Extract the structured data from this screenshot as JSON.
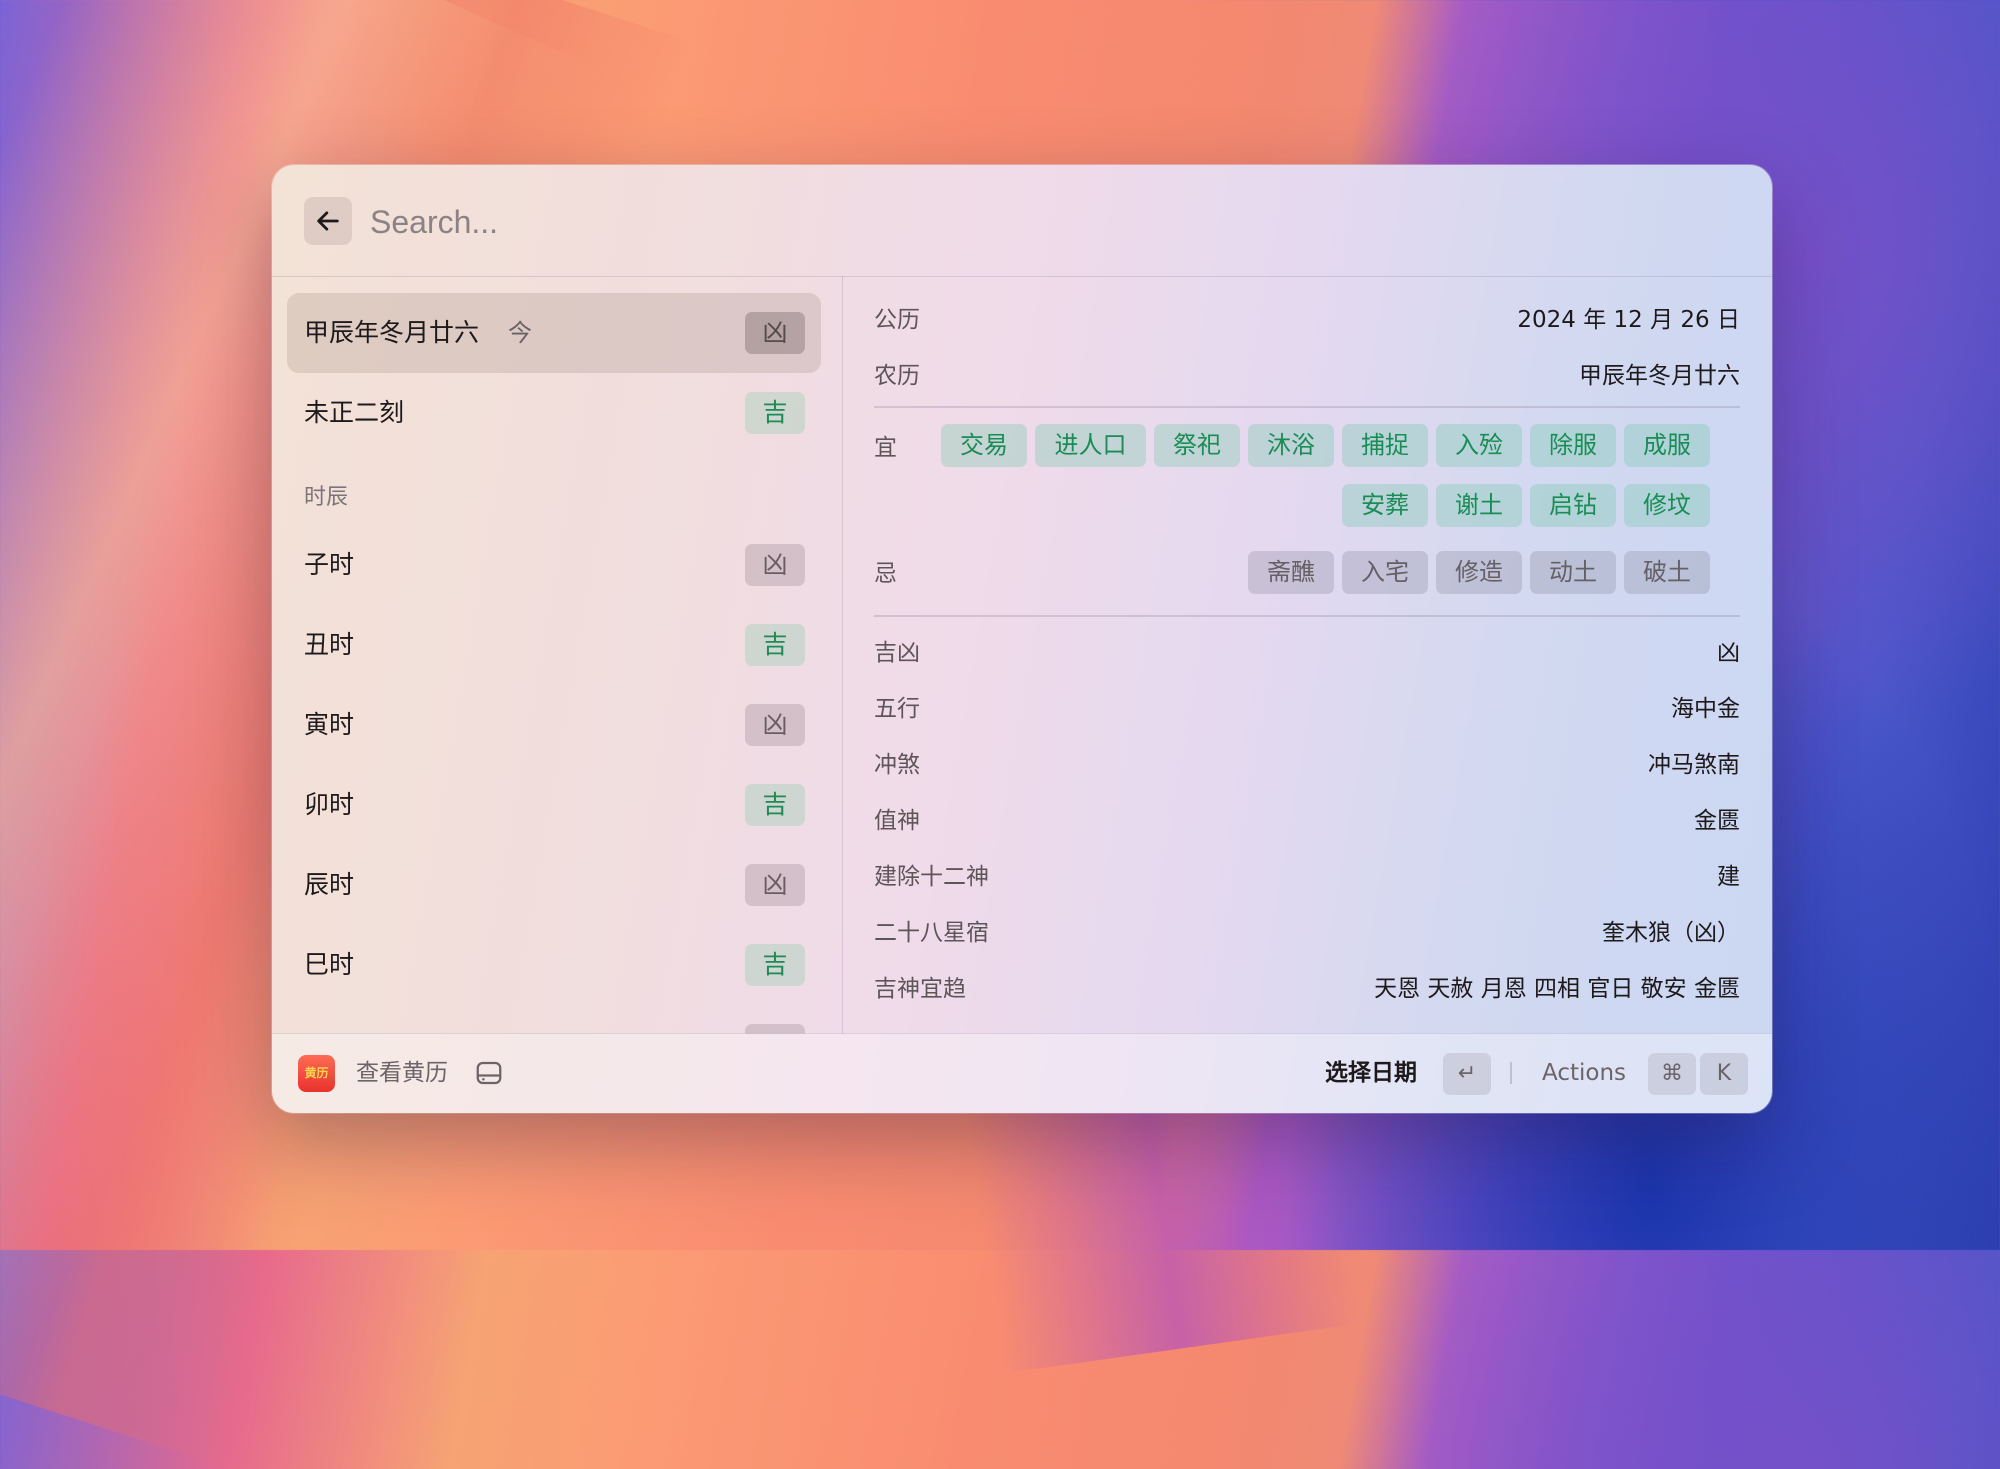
{
  "search": {
    "placeholder": "Search..."
  },
  "list": {
    "top_items": [
      {
        "label": "甲辰年冬月廿六",
        "today": "今",
        "badge": "凶",
        "badge_type": "bad",
        "selected": true
      },
      {
        "label": "未正二刻",
        "badge": "吉",
        "badge_type": "good",
        "selected": false
      }
    ],
    "section_label": "时辰",
    "hours": [
      {
        "label": "子时",
        "badge": "凶",
        "badge_type": "bad"
      },
      {
        "label": "丑时",
        "badge": "吉",
        "badge_type": "good"
      },
      {
        "label": "寅时",
        "badge": "凶",
        "badge_type": "bad"
      },
      {
        "label": "卯时",
        "badge": "吉",
        "badge_type": "good"
      },
      {
        "label": "辰时",
        "badge": "凶",
        "badge_type": "bad"
      },
      {
        "label": "巳时",
        "badge": "吉",
        "badge_type": "good"
      }
    ]
  },
  "detail": {
    "solar_label": "公历",
    "solar_value": "2024 年 12 月 26 日",
    "lunar_label": "农历",
    "lunar_value": "甲辰年冬月廿六",
    "yi_label": "宜",
    "yi_row1": [
      "交易",
      "进人口",
      "祭祀",
      "沐浴",
      "捕捉",
      "入殓",
      "除服",
      "成服"
    ],
    "yi_row2": [
      "安葬",
      "谢土",
      "启钻",
      "修坟"
    ],
    "ji_label": "忌",
    "ji": [
      "斋醮",
      "入宅",
      "修造",
      "动土",
      "破土"
    ],
    "rows": [
      {
        "label": "吉凶",
        "value": "凶"
      },
      {
        "label": "五行",
        "value": "海中金"
      },
      {
        "label": "冲煞",
        "value": "冲马煞南"
      },
      {
        "label": "值神",
        "value": "金匮"
      },
      {
        "label": "建除十二神",
        "value": "建"
      },
      {
        "label": "二十八星宿",
        "value": "奎木狼（凶）"
      },
      {
        "label": "吉神宜趋",
        "value": "天恩 天赦 月恩 四相 官日 敬安 金匮"
      }
    ]
  },
  "footer": {
    "app_icon_text": "黄历",
    "title": "查看黄历",
    "primary_action": "选择日期",
    "enter_key": "↵",
    "actions_label": "Actions",
    "cmd_key": "⌘",
    "k_key": "K"
  },
  "colors": {
    "good": "#1e8b55",
    "bad": "#6a5c63",
    "accent_bg": "#f3e2d6"
  }
}
